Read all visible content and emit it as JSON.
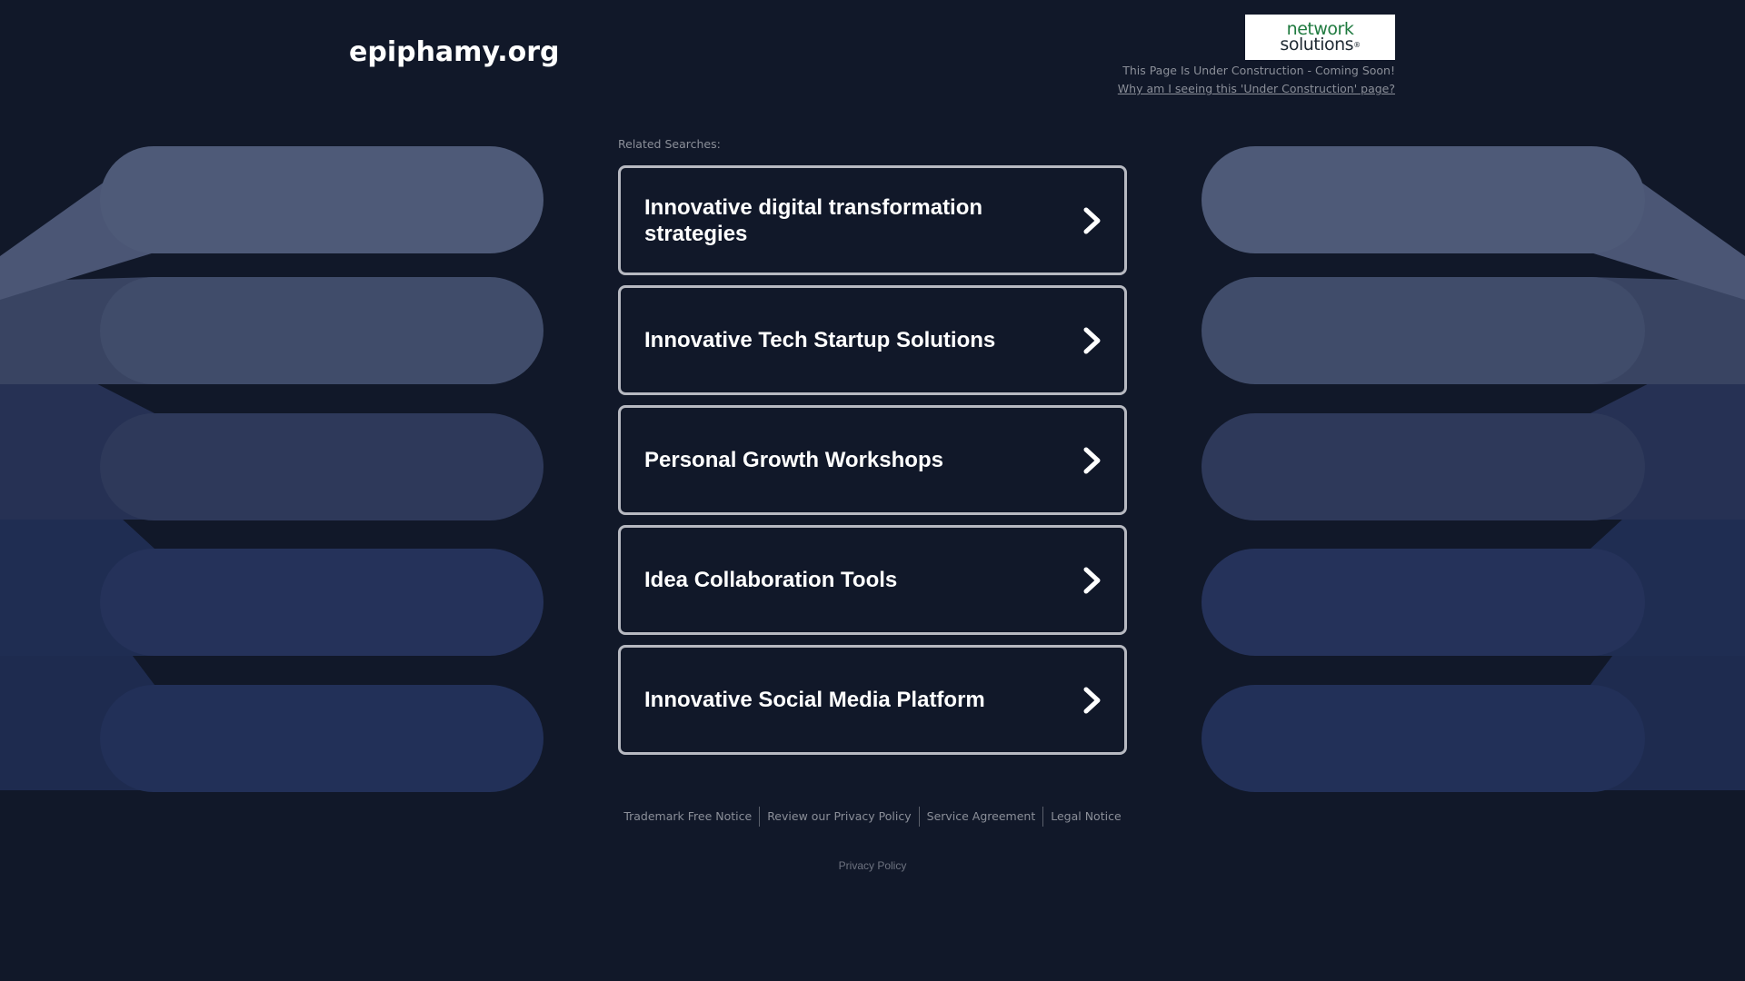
{
  "header": {
    "domain": "epiphamy.org",
    "logo_line1": "network",
    "logo_line2": "solutions",
    "logo_reg": "®",
    "under_construction_text": "This Page Is Under Construction - Coming Soon!",
    "under_construction_link": "Why am I seeing this 'Under Construction' page?"
  },
  "main": {
    "related_label": "Related Searches:",
    "links": [
      {
        "label": "Innovative digital transformation strategies",
        "icon": "chevron-right-icon"
      },
      {
        "label": "Innovative Tech Startup Solutions",
        "icon": "chevron-right-icon"
      },
      {
        "label": "Personal Growth Workshops",
        "icon": "chevron-right-icon"
      },
      {
        "label": "Idea Collaboration Tools",
        "icon": "chevron-right-icon"
      },
      {
        "label": "Innovative Social Media Platform",
        "icon": "chevron-right-icon"
      }
    ]
  },
  "footer": {
    "links": [
      "Trademark Free Notice",
      "Review our Privacy Policy",
      "Service Agreement",
      "Legal Notice"
    ],
    "privacy": "Privacy Policy"
  },
  "colors": {
    "background": "#111829",
    "band_1": "#4e5a78",
    "band_2": "#404c6a",
    "band_3": "#2e395a",
    "band_4": "#25325a",
    "band_5": "#223058",
    "logo_green": "#1f7a3f"
  }
}
